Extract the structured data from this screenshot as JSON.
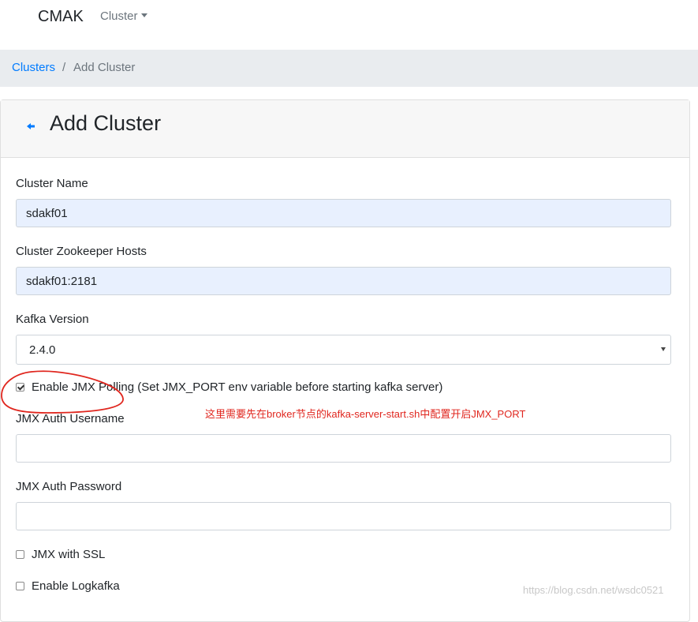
{
  "navbar": {
    "brand": "CMAK",
    "cluster_menu_label": "Cluster"
  },
  "breadcrumb": {
    "link": "Clusters",
    "separator": "/",
    "current": "Add Cluster"
  },
  "card": {
    "title": "Add Cluster",
    "back_icon": "arrow-left-icon"
  },
  "form": {
    "cluster_name": {
      "label": "Cluster Name",
      "value": "sdakf01"
    },
    "zk_hosts": {
      "label": "Cluster Zookeeper Hosts",
      "value": "sdakf01:2181"
    },
    "kafka_version": {
      "label": "Kafka Version",
      "selected": "2.4.0"
    },
    "enable_jmx": {
      "label": "Enable JMX Polling (Set JMX_PORT env variable before starting kafka server)",
      "checked": true
    },
    "jmx_user": {
      "label": "JMX Auth Username",
      "value": ""
    },
    "jmx_password": {
      "label": "JMX Auth Password",
      "value": ""
    },
    "jmx_ssl": {
      "label": "JMX with SSL",
      "checked": false
    },
    "logkafka": {
      "label": "Enable Logkafka",
      "checked": false
    }
  },
  "annotation": {
    "text": "这里需要先在broker节点的kafka-server-start.sh中配置开启JMX_PORT",
    "color": "#e0271f"
  },
  "watermark": "https://blog.csdn.net/wsdc0521",
  "colors": {
    "link": "#007bff",
    "breadcrumb_bg": "#e9ecef",
    "autofill_bg": "#e8f0fe"
  }
}
